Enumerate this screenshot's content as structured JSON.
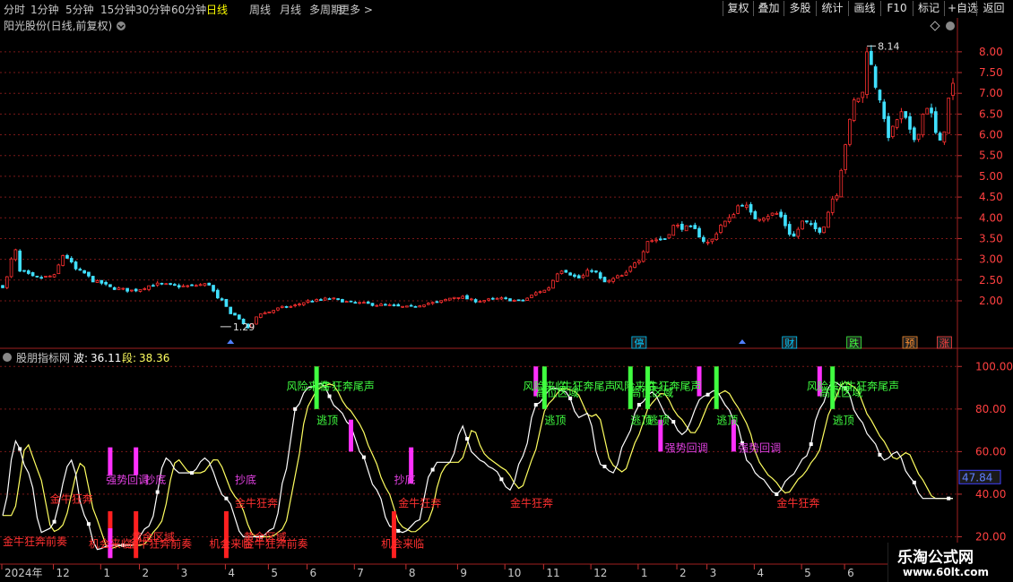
{
  "toolbar": {
    "periods": [
      "分时",
      "1分钟",
      "5分钟",
      "15分钟",
      "30分钟",
      "60分钟",
      "日线",
      "周线",
      "月线",
      "多周期",
      "更多 >"
    ],
    "active_period": "日线",
    "buttons": [
      "复权",
      "叠加",
      "多股",
      "统计",
      "画线",
      "F10",
      "标记",
      "+自选",
      "返回"
    ]
  },
  "main_panel": {
    "title": "阳光股份(日线,前复权)",
    "high_label": "8.14",
    "low_label": "1.29",
    "event_markers": [
      {
        "text": "停",
        "color": "#00c8ff",
        "date_index": 148
      },
      {
        "text": "财",
        "color": "#00c8ff",
        "date_index": 183
      },
      {
        "text": "跌",
        "color": "#40ff40",
        "date_index": 198
      },
      {
        "text": "预",
        "color": "#ff9030",
        "date_index": 211
      },
      {
        "text": "涨",
        "color": "#ff4040",
        "date_index": 219
      }
    ]
  },
  "indicator_panel": {
    "name": "股朋指标网",
    "wave_label": "波:",
    "wave_value": "36.11",
    "segment_label": "段:",
    "segment_value": "38.36",
    "current_value": "47.84"
  },
  "watermark": {
    "line1": "乐淘公式网",
    "line2": "www.60lt.com"
  },
  "chart_data": {
    "type": "candlestick",
    "price_axis": {
      "ticks": [
        2.0,
        2.5,
        3.0,
        3.5,
        4.0,
        4.5,
        5.0,
        5.5,
        6.0,
        6.5,
        7.0,
        7.5,
        8.0
      ],
      "range": [
        1.05,
        8.45
      ]
    },
    "indicator_axis": {
      "ticks": [
        20.0,
        40.0,
        60.0,
        80.0,
        100.0
      ],
      "range": [
        8,
        106
      ]
    },
    "x_labels": [
      {
        "text": "2024年",
        "date_index": 0
      },
      {
        "text": "12",
        "date_index": 12
      },
      {
        "text": "1",
        "date_index": 23
      },
      {
        "text": "2",
        "date_index": 32
      },
      {
        "text": "3",
        "date_index": 41
      },
      {
        "text": "4",
        "date_index": 52
      },
      {
        "text": "5",
        "date_index": 62
      },
      {
        "text": "6",
        "date_index": 71
      },
      {
        "text": "7",
        "date_index": 82
      },
      {
        "text": "8",
        "date_index": 94
      },
      {
        "text": "9",
        "date_index": 106
      },
      {
        "text": "10",
        "date_index": 117
      },
      {
        "text": "11",
        "date_index": 126
      },
      {
        "text": "12",
        "date_index": 137
      },
      {
        "text": "1",
        "date_index": 148
      },
      {
        "text": "2",
        "date_index": 157
      },
      {
        "text": "3",
        "date_index": 164
      },
      {
        "text": "4",
        "date_index": 175
      },
      {
        "text": "5",
        "date_index": 186
      },
      {
        "text": "6",
        "date_index": 196
      }
    ],
    "close_waypoints": [
      [
        0,
        2.35
      ],
      [
        3,
        3.2
      ],
      [
        4,
        2.7
      ],
      [
        8,
        2.55
      ],
      [
        12,
        2.6
      ],
      [
        14,
        3.1
      ],
      [
        18,
        2.7
      ],
      [
        22,
        2.45
      ],
      [
        26,
        2.3
      ],
      [
        30,
        2.25
      ],
      [
        36,
        2.4
      ],
      [
        42,
        2.35
      ],
      [
        48,
        2.4
      ],
      [
        50,
        2.05
      ],
      [
        54,
        1.65
      ],
      [
        57,
        1.35
      ],
      [
        60,
        1.7
      ],
      [
        66,
        1.85
      ],
      [
        72,
        2.0
      ],
      [
        76,
        2.05
      ],
      [
        82,
        1.95
      ],
      [
        88,
        1.9
      ],
      [
        94,
        1.85
      ],
      [
        100,
        1.95
      ],
      [
        106,
        2.1
      ],
      [
        110,
        2.0
      ],
      [
        116,
        2.05
      ],
      [
        120,
        2.0
      ],
      [
        126,
        2.25
      ],
      [
        130,
        2.75
      ],
      [
        134,
        2.55
      ],
      [
        137,
        2.75
      ],
      [
        140,
        2.45
      ],
      [
        144,
        2.6
      ],
      [
        148,
        3.0
      ],
      [
        150,
        3.45
      ],
      [
        154,
        3.5
      ],
      [
        156,
        3.8
      ],
      [
        160,
        3.75
      ],
      [
        164,
        3.4
      ],
      [
        168,
        3.9
      ],
      [
        172,
        4.35
      ],
      [
        175,
        4.0
      ],
      [
        180,
        4.1
      ],
      [
        184,
        3.55
      ],
      [
        186,
        3.9
      ],
      [
        190,
        3.7
      ],
      [
        194,
        4.6
      ],
      [
        196,
        5.8
      ],
      [
        198,
        6.8
      ],
      [
        200,
        7.0
      ],
      [
        201,
        8.1
      ],
      [
        203,
        7.2
      ],
      [
        206,
        6.0
      ],
      [
        209,
        6.5
      ],
      [
        212,
        5.9
      ],
      [
        215,
        6.7
      ],
      [
        218,
        5.8
      ],
      [
        221,
        7.2
      ]
    ],
    "series": [
      {
        "name": "波",
        "color": "#ffffff",
        "values_waypoints": [
          [
            0,
            30
          ],
          [
            3,
            65
          ],
          [
            6,
            50
          ],
          [
            9,
            22
          ],
          [
            11,
            24
          ],
          [
            16,
            56
          ],
          [
            19,
            30
          ],
          [
            22,
            14
          ],
          [
            25,
            16
          ],
          [
            30,
            16
          ],
          [
            34,
            25
          ],
          [
            38,
            57
          ],
          [
            41,
            50
          ],
          [
            44,
            50
          ],
          [
            47,
            57
          ],
          [
            52,
            38
          ],
          [
            56,
            20
          ],
          [
            60,
            20
          ],
          [
            63,
            24
          ],
          [
            66,
            52
          ],
          [
            68,
            80
          ],
          [
            71,
            90
          ],
          [
            74,
            92
          ],
          [
            78,
            80
          ],
          [
            81,
            72
          ],
          [
            83,
            60
          ],
          [
            87,
            42
          ],
          [
            90,
            25
          ],
          [
            93,
            22
          ],
          [
            97,
            28
          ],
          [
            99,
            48
          ],
          [
            101,
            55
          ],
          [
            104,
            55
          ],
          [
            107,
            72
          ],
          [
            109,
            60
          ],
          [
            111,
            56
          ],
          [
            114,
            52
          ],
          [
            118,
            42
          ],
          [
            121,
            58
          ],
          [
            124,
            82
          ],
          [
            128,
            90
          ],
          [
            131,
            88
          ],
          [
            134,
            76
          ],
          [
            136,
            78
          ],
          [
            139,
            54
          ],
          [
            142,
            50
          ],
          [
            145,
            66
          ],
          [
            148,
            82
          ],
          [
            151,
            88
          ],
          [
            155,
            76
          ],
          [
            158,
            68
          ],
          [
            163,
            86
          ],
          [
            166,
            89
          ],
          [
            168,
            82
          ],
          [
            171,
            72
          ],
          [
            173,
            56
          ],
          [
            176,
            48
          ],
          [
            180,
            40
          ],
          [
            183,
            48
          ],
          [
            187,
            58
          ],
          [
            190,
            80
          ],
          [
            193,
            93
          ],
          [
            196,
            90
          ],
          [
            199,
            76
          ],
          [
            202,
            66
          ],
          [
            205,
            56
          ],
          [
            208,
            60
          ],
          [
            211,
            48
          ],
          [
            214,
            38
          ]
        ]
      },
      {
        "name": "段",
        "color": "#ffff60",
        "lag": 2
      }
    ],
    "signals": [
      {
        "text": "金牛狂奔前奏",
        "color": "#ff3030",
        "date_index": 0,
        "value": 16
      },
      {
        "text": "金牛狂奔",
        "color": "#ff3030",
        "date_index": 11,
        "value": 36
      },
      {
        "text": "强势回调",
        "color": "#e040e0",
        "date_index": 24,
        "value": 45
      },
      {
        "text": "抄底",
        "color": "#e040e0",
        "date_index": 33,
        "value": 45
      },
      {
        "text": "机会来临",
        "color": "#ff3030",
        "date_index": 20,
        "value": 15
      },
      {
        "text": "金牛狂奔前奏",
        "color": "#ff3030",
        "date_index": 29,
        "value": 15
      },
      {
        "text": "黄金区域",
        "color": "#ff3030",
        "date_index": 30,
        "value": 18
      },
      {
        "text": "抄底",
        "color": "#e040e0",
        "date_index": 54,
        "value": 45
      },
      {
        "text": "金牛狂奔",
        "color": "#ff3030",
        "date_index": 54,
        "value": 34
      },
      {
        "text": "机会来临",
        "color": "#ff3030",
        "date_index": 48,
        "value": 15
      },
      {
        "text": "金牛狂奔前奏",
        "color": "#ff3030",
        "date_index": 56,
        "value": 15
      },
      {
        "text": "黄金区域",
        "color": "#ff3030",
        "date_index": 56,
        "value": 18
      },
      {
        "text": "风险来临",
        "color": "#40ff40",
        "date_index": 66,
        "value": 89
      },
      {
        "text": "牛狂奔尾声",
        "color": "#40ff40",
        "date_index": 74,
        "value": 89
      },
      {
        "text": "逃顶",
        "color": "#40ff40",
        "date_index": 73,
        "value": 73
      },
      {
        "text": "抄底",
        "color": "#e040e0",
        "date_index": 91,
        "value": 45
      },
      {
        "text": "金牛狂奔",
        "color": "#ff3030",
        "date_index": 92,
        "value": 34
      },
      {
        "text": "机会来临",
        "color": "#ff3030",
        "date_index": 88,
        "value": 15
      },
      {
        "text": "金牛狂奔",
        "color": "#ff3030",
        "date_index": 118,
        "value": 34
      },
      {
        "text": "风险来临",
        "color": "#40ff40",
        "date_index": 121,
        "value": 89
      },
      {
        "text": "高位区域",
        "color": "#40ff40",
        "date_index": 124,
        "value": 86
      },
      {
        "text": "牛狂奔尾声",
        "color": "#40ff40",
        "date_index": 130,
        "value": 89
      },
      {
        "text": "逃顶",
        "color": "#40ff40",
        "date_index": 126,
        "value": 73
      },
      {
        "text": "风险来临",
        "color": "#40ff40",
        "date_index": 142,
        "value": 89
      },
      {
        "text": "高位区域",
        "color": "#40ff40",
        "date_index": 146,
        "value": 86
      },
      {
        "text": "牛狂奔尾声",
        "color": "#40ff40",
        "date_index": 150,
        "value": 89
      },
      {
        "text": "逃顶",
        "color": "#40ff40",
        "date_index": 146,
        "value": 73
      },
      {
        "text": "逃顶",
        "color": "#40ff40",
        "date_index": 150,
        "value": 73
      },
      {
        "text": "强势回调",
        "color": "#e040e0",
        "date_index": 154,
        "value": 60
      },
      {
        "text": "逃顶",
        "color": "#40ff40",
        "date_index": 166,
        "value": 73
      },
      {
        "text": "强势回调",
        "color": "#e040e0",
        "date_index": 171,
        "value": 60
      },
      {
        "text": "金牛狂奔",
        "color": "#ff3030",
        "date_index": 180,
        "value": 34
      },
      {
        "text": "风险来临",
        "color": "#40ff40",
        "date_index": 187,
        "value": 89
      },
      {
        "text": "高位区域",
        "color": "#40ff40",
        "date_index": 190,
        "value": 86
      },
      {
        "text": "牛狂奔尾声",
        "color": "#40ff40",
        "date_index": 196,
        "value": 89
      },
      {
        "text": "逃顶",
        "color": "#40ff40",
        "date_index": 193,
        "value": 73
      }
    ],
    "bars": [
      {
        "date_index": 25,
        "color": "#ff2020",
        "from": 10,
        "to": 32
      },
      {
        "date_index": 25,
        "color": "#ff30ff",
        "from": 10,
        "to": 24
      },
      {
        "date_index": 31,
        "color": "#ff2020",
        "from": 10,
        "to": 32
      },
      {
        "date_index": 25,
        "color": "#ff30ff",
        "from": 49,
        "to": 62
      },
      {
        "date_index": 31,
        "color": "#ff30ff",
        "from": 49,
        "to": 62
      },
      {
        "date_index": 52,
        "color": "#ff2020",
        "from": 10,
        "to": 32
      },
      {
        "date_index": 81,
        "color": "#ff30ff",
        "from": 60,
        "to": 75
      },
      {
        "date_index": 91,
        "color": "#ff2020",
        "from": 10,
        "to": 32
      },
      {
        "date_index": 95,
        "color": "#ff30ff",
        "from": 45,
        "to": 62
      },
      {
        "date_index": 73,
        "color": "#40ff40",
        "from": 80,
        "to": 100
      },
      {
        "date_index": 124,
        "color": "#ff30ff",
        "from": 86,
        "to": 100
      },
      {
        "date_index": 126,
        "color": "#40ff40",
        "from": 80,
        "to": 100
      },
      {
        "date_index": 146,
        "color": "#40ff40",
        "from": 80,
        "to": 100
      },
      {
        "date_index": 150,
        "color": "#40ff40",
        "from": 80,
        "to": 100
      },
      {
        "date_index": 153,
        "color": "#ff30ff",
        "from": 60,
        "to": 75
      },
      {
        "date_index": 162,
        "color": "#ff30ff",
        "from": 86,
        "to": 100
      },
      {
        "date_index": 166,
        "color": "#40ff40",
        "from": 80,
        "to": 100
      },
      {
        "date_index": 170,
        "color": "#ff30ff",
        "from": 60,
        "to": 75
      },
      {
        "date_index": 190,
        "color": "#ff30ff",
        "from": 86,
        "to": 100
      },
      {
        "date_index": 193,
        "color": "#40ff40",
        "from": 80,
        "to": 100
      }
    ],
    "dots_every": 8
  }
}
